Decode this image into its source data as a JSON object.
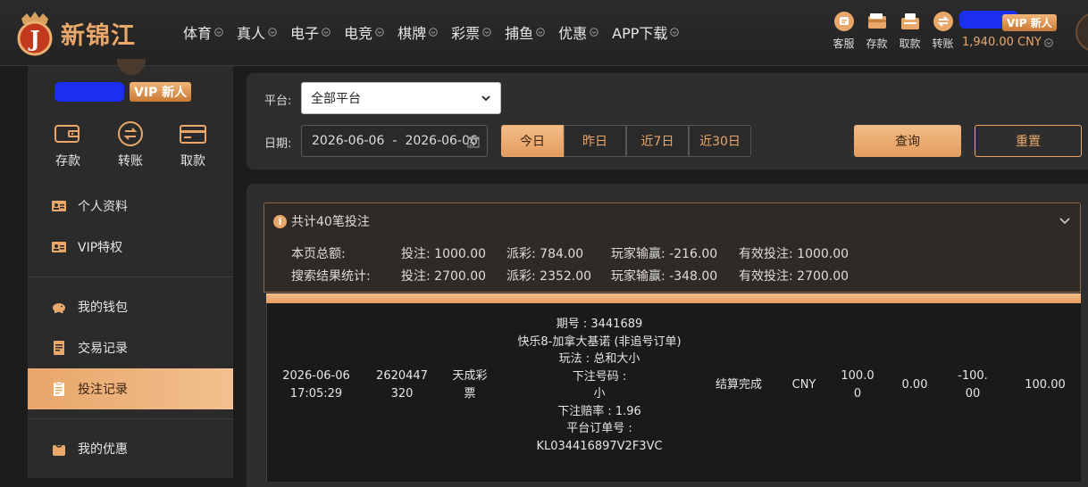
{
  "header": {
    "logo_text": "新锦江",
    "nav": [
      {
        "label": "体育"
      },
      {
        "label": "真人"
      },
      {
        "label": "电子"
      },
      {
        "label": "电竞"
      },
      {
        "label": "棋牌"
      },
      {
        "label": "彩票"
      },
      {
        "label": "捕鱼"
      },
      {
        "label": "优惠"
      },
      {
        "label": "APP下载"
      }
    ],
    "actions": [
      {
        "label": "客服",
        "icon": "customer-service-icon"
      },
      {
        "label": "存款",
        "icon": "deposit-icon"
      },
      {
        "label": "取款",
        "icon": "withdraw-icon"
      },
      {
        "label": "转账",
        "icon": "transfer-icon"
      }
    ],
    "vip_badge": "VIP 新人",
    "balance": "1,940.00 CNY"
  },
  "sidebar": {
    "vip_badge": "VIP 新人",
    "wallet": [
      {
        "label": "存款",
        "icon": "wallet-icon"
      },
      {
        "label": "转账",
        "icon": "transfer-circle-icon"
      },
      {
        "label": "取款",
        "icon": "card-icon"
      }
    ],
    "group1": [
      {
        "label": "个人资料",
        "icon": "profile-card-icon"
      },
      {
        "label": "VIP特权",
        "icon": "vip-card-icon"
      }
    ],
    "group2": [
      {
        "label": "我的钱包",
        "icon": "piggy-bank-icon"
      },
      {
        "label": "交易记录",
        "icon": "ledger-icon"
      },
      {
        "label": "投注记录",
        "icon": "clipboard-icon",
        "active": true
      }
    ],
    "group3": [
      {
        "label": "我的优惠",
        "icon": "gift-icon"
      }
    ]
  },
  "filters": {
    "platform_label": "平台:",
    "platform_value": "全部平台",
    "date_label": "日期:",
    "date_start": "2026-06-06",
    "date_sep": "-",
    "date_end": "2026-06-06",
    "ranges": [
      "今日",
      "昨日",
      "近7日",
      "近30日"
    ],
    "query_label": "查询",
    "reset_label": "重置"
  },
  "summary": {
    "title": "共计40笔投注",
    "page_label": "本页总额:",
    "page": {
      "bet": "投注: 1000.00",
      "payout": "派彩: 784.00",
      "winloss": "玩家输赢: -216.00",
      "valid": "有效投注: 1000.00"
    },
    "search_label": "搜索结果统计:",
    "search": {
      "bet": "投注: 2700.00",
      "payout": "派彩: 2352.00",
      "winloss": "玩家输赢: -348.00",
      "valid": "有效投注: 2700.00"
    }
  },
  "record": {
    "date": "2026-06-06",
    "time": "17:05:29",
    "order_a": "2620447",
    "order_b": "320",
    "game_a": "天成彩",
    "game_b": "票",
    "detail": [
      "期号 : 3441689",
      "快乐8-加拿大基诺 (非追号订单)",
      "玩法 : 总和大小",
      "下注号码 :",
      "小",
      "下注赔率 : 1.96",
      "平台订单号 :",
      "KL034416897V2F3VC"
    ],
    "status": "结算完成",
    "currency": "CNY",
    "bet_a": "100.0",
    "bet_b": "0",
    "payout": "0.00",
    "winloss_a": "-100.",
    "winloss_b": "00",
    "valid": "100.00"
  },
  "colors": {
    "accent": "#e9a86a",
    "panel": "#2e2e2e",
    "background": "#1c1c1c"
  }
}
